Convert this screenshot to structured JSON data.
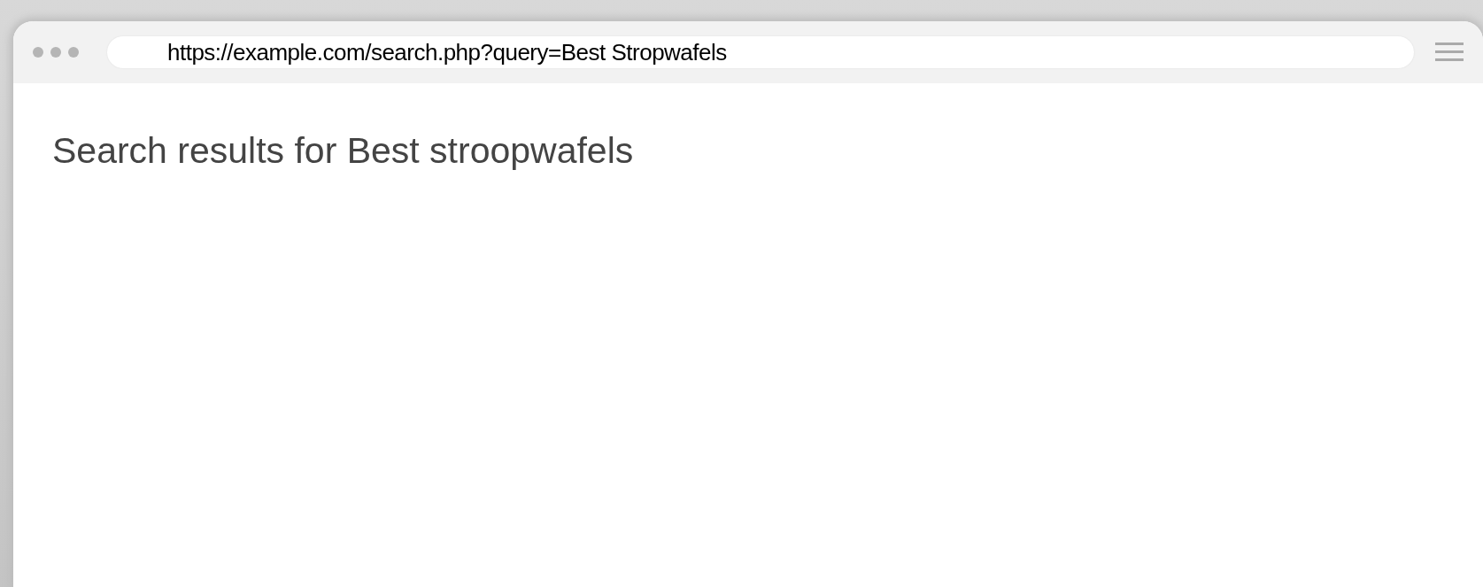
{
  "browser": {
    "url": "https://example.com/search.php?query=Best Stropwafels"
  },
  "page": {
    "heading": "Search results for Best stroopwafels"
  }
}
